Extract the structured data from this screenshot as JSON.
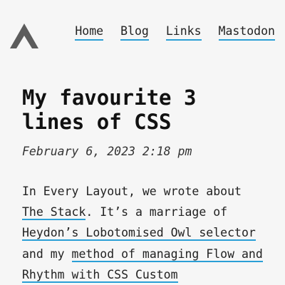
{
  "header": {
    "logo_icon": "mountain-logo-icon",
    "nav": [
      {
        "label": "Home"
      },
      {
        "label": "Blog"
      },
      {
        "label": "Links"
      },
      {
        "label": "Mastodon"
      }
    ]
  },
  "article": {
    "title": "My favourite 3 lines of CSS",
    "date": "February 6, 2023 2:18 pm",
    "paragraph": {
      "t1": "In Every Layout, we wrote about ",
      "link1": "The Stack",
      "t2": ". It’s a marriage of ",
      "link2": "Heydon’s Lobotomised Owl selector",
      "t3": " and my ",
      "link3": "method of managing Flow and Rhythm with CSS Custom"
    }
  },
  "colors": {
    "accent": "#2a9fd6",
    "background": "#f6f6f6",
    "logo": "#5c5c5c"
  }
}
